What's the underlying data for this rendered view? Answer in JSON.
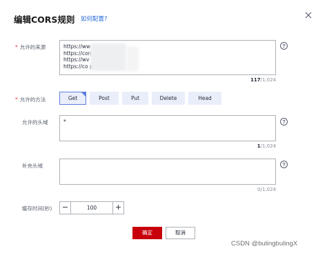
{
  "dialog": {
    "title": "编辑CORS规则",
    "help_link": "如何配置?"
  },
  "origin": {
    "label": "允许的来源",
    "required_mark": "*",
    "lines": [
      "https://ww",
      "https://con                              om",
      "https://wv",
      "https://co                               p"
    ],
    "count": "117",
    "max": "/1,024"
  },
  "methods": {
    "label": "允许的方法",
    "required_mark": "*",
    "items": [
      {
        "label": "Get",
        "selected": true
      },
      {
        "label": "Post",
        "selected": false
      },
      {
        "label": "Put",
        "selected": false
      },
      {
        "label": "Delete",
        "selected": false
      },
      {
        "label": "Head",
        "selected": false
      }
    ]
  },
  "allowed_headers": {
    "label": "允许的头域",
    "value": "*",
    "count": "1",
    "max": "/1,024"
  },
  "expose_headers": {
    "label": "补充头域",
    "value": "",
    "count": "0",
    "max": "/1,024"
  },
  "cache": {
    "label": "缓存时间(秒)",
    "value": "100",
    "minus": "−",
    "plus": "+"
  },
  "actions": {
    "ok": "确定",
    "cancel": "取消"
  },
  "help_glyph": "?",
  "watermark": "CSDN @bulingbulingX",
  "colors": {
    "primary": "#c7000b",
    "selected_border": "#5e7ce0",
    "link": "#2a6cd6"
  }
}
